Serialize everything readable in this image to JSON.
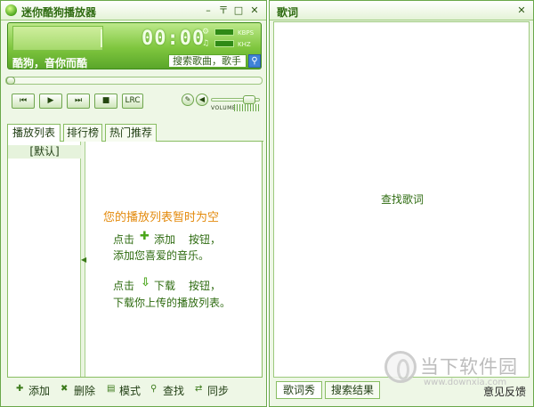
{
  "player": {
    "title": "迷你酷狗播放器",
    "window_buttons": {
      "minimize": "–",
      "options": "〒",
      "restore": "□",
      "close": "✕"
    },
    "time": "00:00",
    "kbps_label": "KBPS",
    "khz_label": "KHZ",
    "song_text": "酷狗，音你而酷",
    "search_value": "搜索歌曲，歌手",
    "controls": {
      "prev": "⏮",
      "play": "▶",
      "next": "⏭",
      "stop": "■",
      "lrc": "LRC",
      "edit": "✎",
      "volume_icon": "◀"
    },
    "volume_label": "VOLUME",
    "volume_level": 0.9
  },
  "tabs": [
    "播放列表",
    "排行榜",
    "热门推荐"
  ],
  "playlist": {
    "default_item": "[默认]",
    "empty_title": "您的播放列表暂时为空",
    "hint_click": "点击",
    "add_label": "添加",
    "add_button_suffix": "按钮，",
    "add_desc": "添加您喜爱的音乐。",
    "download_label": "下载",
    "download_button_suffix": "按钮，",
    "download_desc": "下载你上传的播放列表。"
  },
  "bottombar": [
    "添加",
    "删除",
    "模式",
    "查找",
    "同步"
  ],
  "lyrics": {
    "title": "歌词",
    "close": "✕",
    "find_text": "查找歌词",
    "tabs": [
      "歌词秀",
      "搜索结果"
    ],
    "feedback": "意见反馈"
  },
  "watermark": {
    "text": "当下软件园",
    "url": "www.downxia.com"
  }
}
